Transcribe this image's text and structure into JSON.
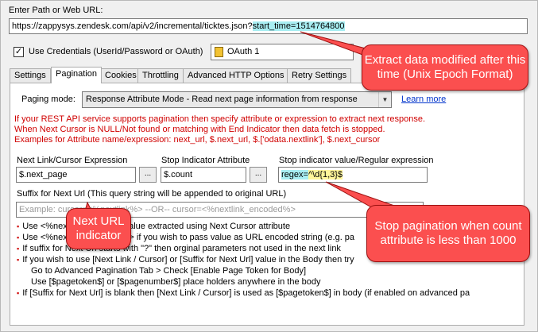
{
  "url_section": {
    "label": "Enter Path or Web URL:",
    "url_prefix": "https://zappysys.zendesk.com/api/v2/incremental/ticktes.json?",
    "url_highlight": "start_time=1514764800"
  },
  "credentials": {
    "checkbox_label": "Use Credentials (UserId/Password or OAuth)",
    "checked": true,
    "connection_value": "OAuth 1"
  },
  "tabs": [
    {
      "label": "Settings",
      "active": false
    },
    {
      "label": "Pagination",
      "active": true
    },
    {
      "label": "Cookies",
      "active": false
    },
    {
      "label": "Throttling",
      "active": false
    },
    {
      "label": "Advanced HTTP Options",
      "active": false
    },
    {
      "label": "Retry Settings",
      "active": false
    }
  ],
  "paging": {
    "mode_label": "Paging mode:",
    "mode_value": "Response Attribute Mode - Read next page information from response",
    "learn_more": "Learn more"
  },
  "info_lines": [
    "If your REST API service supports pagination then specify attribute or expression to extract next response.",
    "When Next Cursor is NULL/Not found or matching with End Indicator then data fetch is stopped.",
    "Examples for Attribute name/expression:  next_url, $.next_url,  $.['odata.nextlink'], $.next_cursor"
  ],
  "fields": {
    "next_link_label": "Next Link/Cursor Expression",
    "next_link_value": "$.next_page",
    "stop_attr_label": "Stop Indicator Attribute",
    "stop_attr_value": "$.count",
    "stop_value_label": "Stop indicator value/Regular expression",
    "stop_value_prefix": "regex=",
    "stop_value_hl": "^\\d{1,3}$",
    "browse_label": "..."
  },
  "suffix": {
    "label": "Suffix for Next Url  (This query string will be appended to original URL)",
    "placeholder": "Example: cursor=<%nextlink%> --OR-- cursor=<%nextlink_encoded%>"
  },
  "bullets": [
    "Use <%nextlink%> to use value extracted using Next Cursor attribute",
    "Use <%nextlink_encoded%> if you wish to pass value as URL encoded string (e.g. pa",
    "If suffix for Next Url starts with \"?\" then orginal parameters not used in the next link",
    "If you wish to use [Next Link / Cursor] or [Suffix for Next Url] value in the Body then try",
    "If [Suffix for Next Url] is blank then [Next Link / Cursor] is used as [$pagetoken$] in body (if enabled on advanced pa"
  ],
  "bullet_sub": [
    "Go to Advanced Pagination Tab > Check [Enable Page Token for Body]",
    "Use [$pagetoken$] or [$pagenumber$] place holders anywhere in the body"
  ],
  "callouts": {
    "extract": "Extract data modified after this time (Unix Epoch Format)",
    "next_url": "Next URL indicator",
    "stop": "Stop pagination when count attribute is less than 1000"
  },
  "colors": {
    "callout_fill": "#fb4f4f",
    "highlight_cyan": "#a8eef2",
    "highlight_yellow": "#fff59a",
    "info_red": "#d00000"
  }
}
